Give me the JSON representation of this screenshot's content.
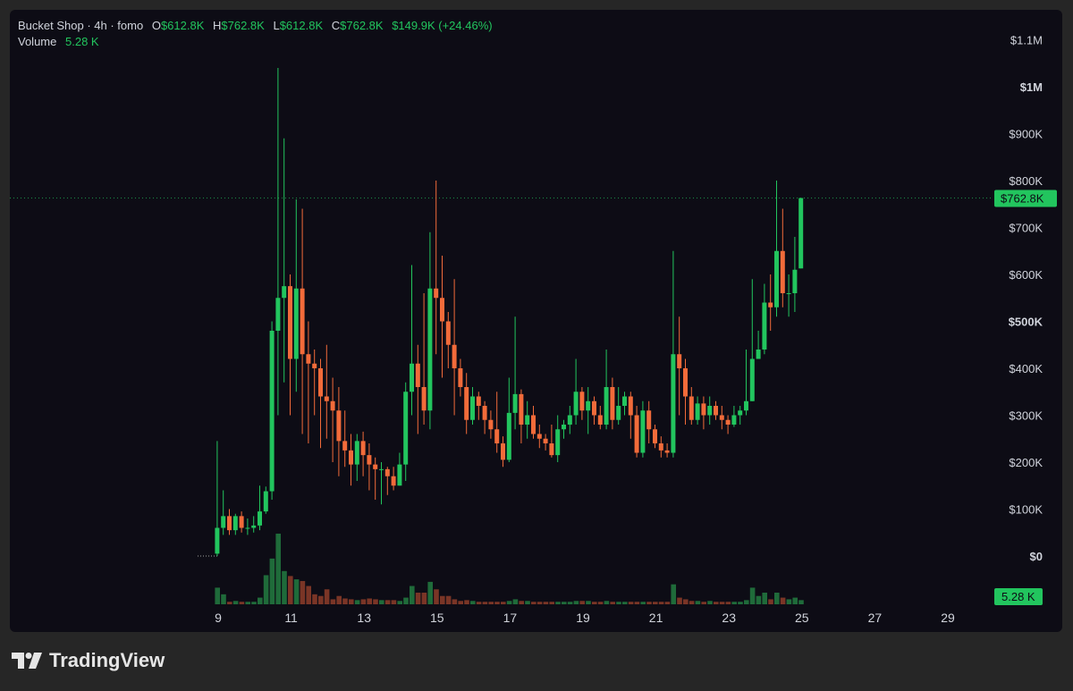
{
  "header": {
    "symbol": "Bucket Shop · 4h · fomo",
    "open_label": "O",
    "open": "$612.8K",
    "high_label": "H",
    "high": "$762.8K",
    "low_label": "L",
    "low": "$612.8K",
    "close_label": "C",
    "close": "$762.8K",
    "change": "$149.9K (+24.46%)",
    "volume_label": "Volume",
    "volume": "5.28 K"
  },
  "price_badge": "$762.8K",
  "volume_badge": "5.28 K",
  "brand": "TradingView",
  "colors": {
    "up": "#22c55e",
    "down": "#f26b3a",
    "up_vol": "#1f6b3a",
    "down_vol": "#7a3526",
    "background": "#0d0c15"
  },
  "chart_data": {
    "type": "candlestick",
    "interval": "4h",
    "y_axis": {
      "ticks": [
        {
          "value": 1100000,
          "label": "$1.1M",
          "strong": false
        },
        {
          "value": 1000000,
          "label": "$1M",
          "strong": true
        },
        {
          "value": 900000,
          "label": "$900K",
          "strong": false
        },
        {
          "value": 800000,
          "label": "$800K",
          "strong": false
        },
        {
          "value": 700000,
          "label": "$700K",
          "strong": false
        },
        {
          "value": 600000,
          "label": "$600K",
          "strong": false
        },
        {
          "value": 500000,
          "label": "$500K",
          "strong": true
        },
        {
          "value": 400000,
          "label": "$400K",
          "strong": false
        },
        {
          "value": 300000,
          "label": "$300K",
          "strong": false
        },
        {
          "value": 200000,
          "label": "$200K",
          "strong": false
        },
        {
          "value": 100000,
          "label": "$100K",
          "strong": false
        },
        {
          "value": 0,
          "label": "$0",
          "strong": true
        }
      ],
      "range": [
        -100000,
        1150000
      ]
    },
    "x_axis": {
      "ticks": [
        {
          "day": 9,
          "label": "9"
        },
        {
          "day": 11,
          "label": "11"
        },
        {
          "day": 13,
          "label": "13"
        },
        {
          "day": 15,
          "label": "15"
        },
        {
          "day": 17,
          "label": "17"
        },
        {
          "day": 19,
          "label": "19"
        },
        {
          "day": 21,
          "label": "21"
        },
        {
          "day": 23,
          "label": "23"
        },
        {
          "day": 25,
          "label": "25"
        },
        {
          "day": 27,
          "label": "27"
        },
        {
          "day": 29,
          "label": "29"
        }
      ],
      "range": [
        8.6,
        30.3
      ]
    },
    "last_price": 762800,
    "candles_ohlc_in_thousands": [
      [
        0,
        0,
        0,
        0
      ],
      [
        0,
        0,
        0,
        0
      ],
      [
        0,
        0,
        0,
        0
      ],
      [
        5,
        60,
        245,
        0
      ],
      [
        60,
        85,
        140,
        45
      ],
      [
        85,
        55,
        100,
        45
      ],
      [
        55,
        85,
        90,
        45
      ],
      [
        85,
        60,
        95,
        50
      ],
      [
        60,
        60,
        80,
        45
      ],
      [
        60,
        65,
        85,
        50
      ],
      [
        65,
        95,
        150,
        55
      ],
      [
        95,
        138,
        148,
        90
      ],
      [
        138,
        480,
        500,
        120
      ],
      [
        480,
        550,
        1040,
        300
      ],
      [
        550,
        575,
        890,
        370
      ],
      [
        575,
        420,
        600,
        300
      ],
      [
        420,
        570,
        760,
        350
      ],
      [
        570,
        430,
        740,
        260
      ],
      [
        430,
        410,
        500,
        240
      ],
      [
        410,
        400,
        440,
        300
      ],
      [
        400,
        340,
        420,
        230
      ],
      [
        340,
        330,
        450,
        250
      ],
      [
        330,
        310,
        380,
        200
      ],
      [
        310,
        245,
        360,
        170
      ],
      [
        245,
        225,
        310,
        190
      ],
      [
        225,
        195,
        260,
        150
      ],
      [
        195,
        245,
        260,
        160
      ],
      [
        245,
        215,
        265,
        170
      ],
      [
        215,
        195,
        240,
        140
      ],
      [
        195,
        185,
        210,
        120
      ],
      [
        185,
        185,
        200,
        110
      ],
      [
        185,
        170,
        190,
        130
      ],
      [
        170,
        150,
        190,
        140
      ],
      [
        150,
        195,
        220,
        150
      ],
      [
        195,
        350,
        370,
        160
      ],
      [
        350,
        410,
        620,
        300
      ],
      [
        410,
        360,
        450,
        260
      ],
      [
        360,
        310,
        560,
        280
      ],
      [
        310,
        570,
        690,
        270
      ],
      [
        570,
        550,
        800,
        430
      ],
      [
        550,
        500,
        640,
        380
      ],
      [
        500,
        450,
        520,
        400
      ],
      [
        450,
        400,
        590,
        300
      ],
      [
        400,
        360,
        420,
        340
      ],
      [
        360,
        290,
        390,
        260
      ],
      [
        290,
        340,
        360,
        280
      ],
      [
        340,
        320,
        350,
        290
      ],
      [
        320,
        290,
        330,
        260
      ],
      [
        290,
        270,
        310,
        250
      ],
      [
        270,
        240,
        350,
        220
      ],
      [
        240,
        205,
        255,
        190
      ],
      [
        205,
        305,
        380,
        200
      ],
      [
        305,
        345,
        510,
        270
      ],
      [
        345,
        280,
        355,
        240
      ],
      [
        280,
        300,
        330,
        250
      ],
      [
        300,
        260,
        320,
        250
      ],
      [
        260,
        250,
        280,
        230
      ],
      [
        250,
        240,
        260,
        225
      ],
      [
        240,
        215,
        280,
        210
      ],
      [
        215,
        270,
        300,
        200
      ],
      [
        270,
        280,
        290,
        250
      ],
      [
        280,
        300,
        320,
        260
      ],
      [
        300,
        350,
        420,
        280
      ],
      [
        350,
        310,
        360,
        290
      ],
      [
        310,
        330,
        360,
        260
      ],
      [
        330,
        300,
        340,
        280
      ],
      [
        300,
        280,
        320,
        270
      ],
      [
        280,
        360,
        440,
        270
      ],
      [
        360,
        290,
        380,
        270
      ],
      [
        290,
        320,
        360,
        280
      ],
      [
        320,
        340,
        350,
        300
      ],
      [
        340,
        300,
        350,
        250
      ],
      [
        300,
        220,
        320,
        210
      ],
      [
        220,
        310,
        330,
        210
      ],
      [
        310,
        270,
        330,
        240
      ],
      [
        270,
        240,
        280,
        230
      ],
      [
        240,
        225,
        255,
        210
      ],
      [
        225,
        220,
        240,
        210
      ],
      [
        220,
        430,
        650,
        210
      ],
      [
        430,
        400,
        510,
        300
      ],
      [
        400,
        340,
        420,
        280
      ],
      [
        340,
        290,
        360,
        280
      ],
      [
        290,
        325,
        340,
        280
      ],
      [
        325,
        300,
        340,
        270
      ],
      [
        300,
        320,
        340,
        280
      ],
      [
        320,
        300,
        330,
        290
      ],
      [
        300,
        290,
        320,
        270
      ],
      [
        290,
        280,
        300,
        260
      ],
      [
        280,
        300,
        320,
        275
      ],
      [
        300,
        310,
        320,
        280
      ],
      [
        310,
        330,
        440,
        300
      ],
      [
        330,
        420,
        590,
        330
      ],
      [
        420,
        440,
        480,
        420
      ],
      [
        440,
        540,
        580,
        430
      ],
      [
        540,
        530,
        600,
        480
      ],
      [
        530,
        650,
        800,
        510
      ],
      [
        650,
        560,
        740,
        530
      ],
      [
        560,
        560,
        600,
        510
      ],
      [
        560,
        610,
        680,
        520
      ],
      [
        612.8,
        762.8,
        762.8,
        612.8
      ]
    ],
    "volume_in_thousands": [
      0,
      0,
      0,
      20,
      12,
      3,
      4,
      3,
      3,
      3,
      8,
      35,
      55,
      85,
      40,
      34,
      30,
      28,
      22,
      12,
      10,
      18,
      6,
      10,
      7,
      6,
      5,
      6,
      7,
      6,
      5,
      5,
      5,
      4,
      8,
      22,
      14,
      14,
      27,
      18,
      10,
      10,
      6,
      4,
      5,
      4,
      3,
      3,
      3,
      3,
      3,
      4,
      6,
      4,
      4,
      3,
      3,
      3,
      3,
      3,
      3,
      3,
      4,
      4,
      4,
      3,
      3,
      4,
      3,
      3,
      3,
      3,
      3,
      3,
      3,
      3,
      3,
      3,
      24,
      8,
      6,
      4,
      4,
      3,
      4,
      3,
      3,
      3,
      3,
      3,
      5,
      20,
      10,
      14,
      6,
      14,
      8,
      6,
      8,
      5
    ]
  }
}
